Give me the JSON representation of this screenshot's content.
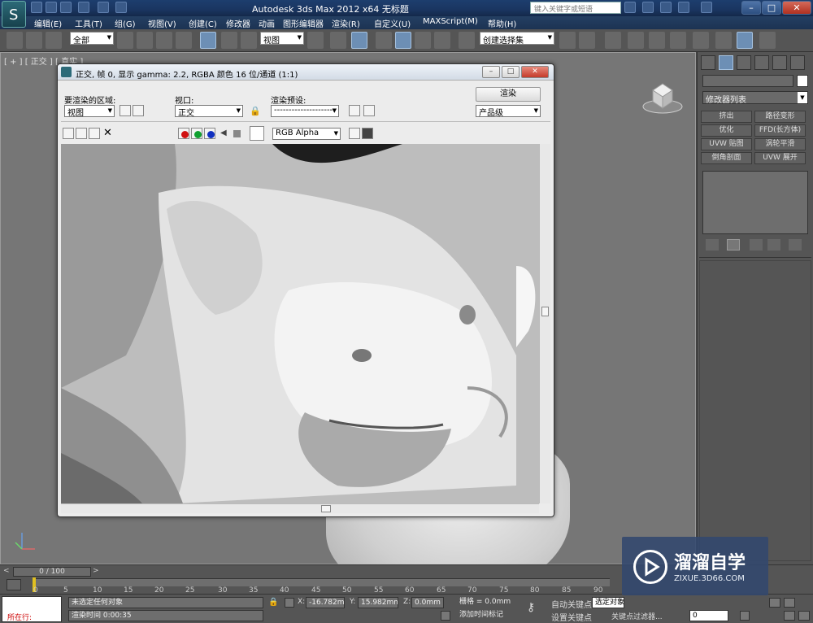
{
  "app": {
    "title": "Autodesk 3ds Max  2012 x64      无标题",
    "search_placeholder": "键入关键字或短语"
  },
  "menu": [
    "编辑(E)",
    "工具(T)",
    "组(G)",
    "视图(V)",
    "创建(C)",
    "修改器",
    "动画",
    "图形编辑器",
    "渲染(R)",
    "自定义(U)",
    "MAXScript(M)",
    "帮助(H)"
  ],
  "toolbar": {
    "selection_filter": "全部",
    "ref_coord": "视图",
    "named_sel": "创建选择集"
  },
  "viewport": {
    "label": "[ + ] [ 正交 ] [ 真实 ]"
  },
  "render_frame": {
    "title": "正交, 帧 0, 显示 gamma: 2.2, RGBA 颜色 16 位/通道 (1:1)",
    "area_label": "要渲染的区域:",
    "area_value": "视图",
    "viewport_label": "视口:",
    "viewport_value": "正交",
    "preset_label": "渲染预设:",
    "preset_value": "--------------------",
    "render_button": "渲染",
    "quality_value": "产品级",
    "channel_value": "RGB Alpha"
  },
  "command_panel": {
    "modifier_list": "修改器列表",
    "modifiers": [
      "挤出",
      "路径变形",
      "优化",
      "FFD(长方体)",
      "UVW 贴图",
      "涡轮平滑",
      "倒角剖面",
      "UVW 展开"
    ]
  },
  "timeline": {
    "frame_display": "0 / 100",
    "ticks": [
      "0",
      "5",
      "10",
      "15",
      "20",
      "25",
      "30",
      "35",
      "40",
      "45",
      "50",
      "55",
      "60",
      "65",
      "70",
      "75",
      "80",
      "85",
      "90"
    ]
  },
  "status": {
    "running_label": "所在行:",
    "message": "未选定任何对象",
    "render_time": "渲染时间  0:00:35",
    "x": "-16.782mm",
    "y": "15.982mm",
    "z": "0.0mm",
    "grid": "栅格 = 0.0mm",
    "add_time_tag": "添加时间标记",
    "auto_key": "自动关键点",
    "set_key": "设置关键点",
    "auto_key_value": "选定对象",
    "key_filters": "关键点过滤器...",
    "frame_field": "0"
  },
  "watermark": {
    "main": "溜溜自学",
    "sub": "ZIXUE.3D66.COM"
  }
}
